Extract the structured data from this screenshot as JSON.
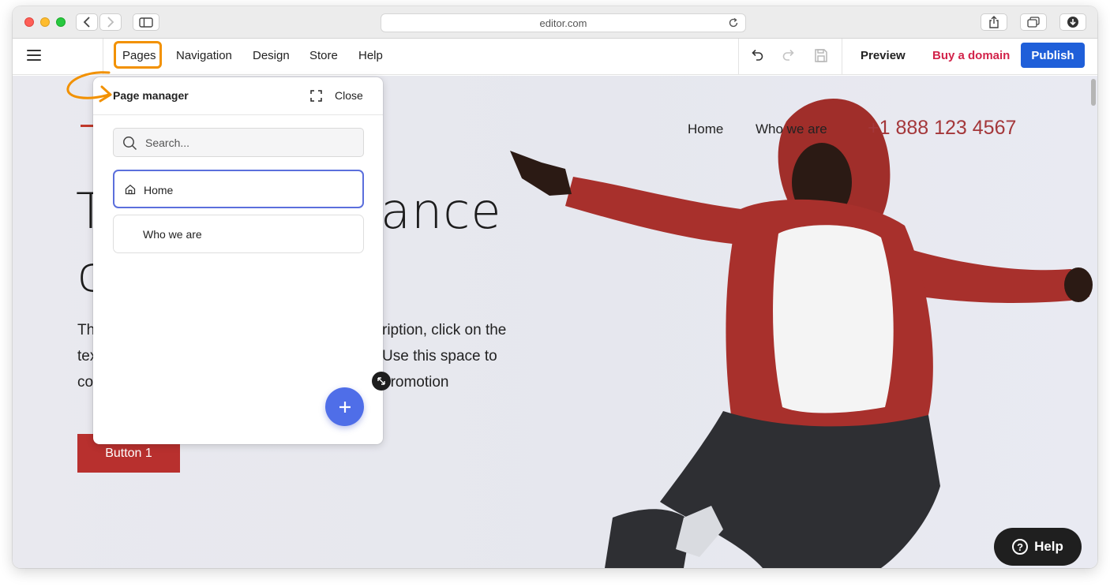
{
  "browser": {
    "url": "editor.com",
    "icons": [
      "back-icon",
      "forward-icon",
      "sidebar-icon",
      "reload-icon",
      "share-icon",
      "tabs-icon",
      "download-icon"
    ]
  },
  "toolbar": {
    "menu": [
      "Pages",
      "Navigation",
      "Design",
      "Store",
      "Help"
    ],
    "preview_label": "Preview",
    "buy_domain_label": "Buy a domain",
    "publish_label": "Publish",
    "highlight_color": "#f29100",
    "publish_color": "#1f5fd9",
    "buy_color": "#d2234a"
  },
  "site": {
    "nav": [
      "Home",
      "Who we are"
    ],
    "phone": "+1 888 123 4567",
    "hero_title_line1_left": "T",
    "hero_title_line1_right": "ance",
    "hero_title_line2_left": "c",
    "hero_body_left": [
      "Th",
      "tex",
      "co"
    ],
    "hero_body_right": [
      "ription, click on the",
      "Use this space to",
      "promotion"
    ],
    "button_label": "Button 1",
    "accent_color": "#b8302e"
  },
  "page_manager": {
    "title": "Page manager",
    "close_label": "Close",
    "search_placeholder": "Search...",
    "pages": [
      {
        "label": "Home",
        "icon": "home-icon",
        "active": true
      },
      {
        "label": "Who we are",
        "active": false
      }
    ],
    "add_color": "#4f6ee8"
  },
  "help_widget": {
    "label": "Help"
  }
}
